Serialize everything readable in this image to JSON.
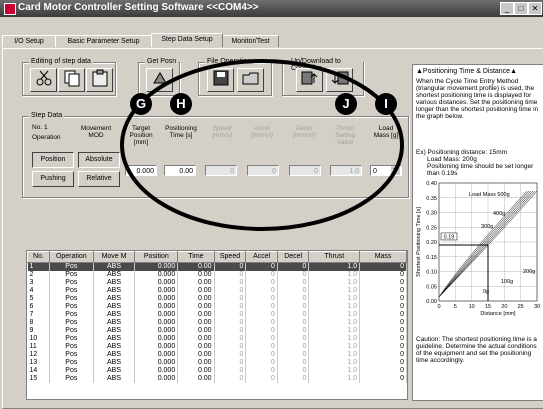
{
  "window": {
    "title": "Card Motor Controller Setting Software <<COM4>>"
  },
  "tabs": [
    "I/O Setup",
    "Basic Parameter Setup",
    "Step Data Setup",
    "Monitor/Test"
  ],
  "toolbar": {
    "editing_label": "Editing of step data",
    "getposn_label": "Get Posn",
    "fileop_label": "File Operation",
    "updown_label": "Up/Download to Controller"
  },
  "markers": [
    "G",
    "H",
    "J",
    "I"
  ],
  "stepdata": {
    "group_label": "Step Data",
    "no_label": "No.",
    "no_value": "1",
    "operation_label": "Operation",
    "movement_label": "Movement MOD",
    "target_label": "Target Position [mm]",
    "postime_label": "Positioning Time [s]",
    "speed_label": "Speed [mm/s]",
    "accel_label": "Accel [mm/s²]",
    "decel_label": "Decel [mm/s²]",
    "thrust_label": "Thrust Setting Value",
    "load_label": "Load Mass [g]",
    "btn_position": "Position",
    "btn_absolute": "Absolute",
    "btn_pushing": "Pushing",
    "btn_relative": "Relative",
    "target_value": "0.000",
    "postime_value": "0.00",
    "speed_value": "0",
    "accel_value": "0",
    "decel_value": "0",
    "thrust_value": "1.0",
    "load_value": "0"
  },
  "table": {
    "headers": [
      "No.",
      "Operation",
      "Move M",
      "Position",
      "Time",
      "Speed",
      "Accel",
      "Decel",
      "Thrust",
      "Mass"
    ],
    "rows": [
      [
        "1",
        "Pos",
        "ABS",
        "0.000",
        "0.00",
        "0",
        "0",
        "0",
        "1.0",
        "0"
      ],
      [
        "2",
        "Pos",
        "ABS",
        "0.000",
        "0.00",
        "0",
        "0",
        "0",
        "1.0",
        "0"
      ],
      [
        "3",
        "Pos",
        "ABS",
        "0.000",
        "0.00",
        "0",
        "0",
        "0",
        "1.0",
        "0"
      ],
      [
        "4",
        "Pos",
        "ABS",
        "0.000",
        "0.00",
        "0",
        "0",
        "0",
        "1.0",
        "0"
      ],
      [
        "5",
        "Pos",
        "ABS",
        "0.000",
        "0.00",
        "0",
        "0",
        "0",
        "1.0",
        "0"
      ],
      [
        "6",
        "Pos",
        "ABS",
        "0.000",
        "0.00",
        "0",
        "0",
        "0",
        "1.0",
        "0"
      ],
      [
        "7",
        "Pos",
        "ABS",
        "0.000",
        "0.00",
        "0",
        "0",
        "0",
        "1.0",
        "0"
      ],
      [
        "8",
        "Pos",
        "ABS",
        "0.000",
        "0.00",
        "0",
        "0",
        "0",
        "1.0",
        "0"
      ],
      [
        "9",
        "Pos",
        "ABS",
        "0.000",
        "0.00",
        "0",
        "0",
        "0",
        "1.0",
        "0"
      ],
      [
        "10",
        "Pos",
        "ABS",
        "0.000",
        "0.00",
        "0",
        "0",
        "0",
        "1.0",
        "0"
      ],
      [
        "11",
        "Pos",
        "ABS",
        "0.000",
        "0.00",
        "0",
        "0",
        "0",
        "1.0",
        "0"
      ],
      [
        "12",
        "Pos",
        "ABS",
        "0.000",
        "0.00",
        "0",
        "0",
        "0",
        "1.0",
        "0"
      ],
      [
        "13",
        "Pos",
        "ABS",
        "0.000",
        "0.00",
        "0",
        "0",
        "0",
        "1.0",
        "0"
      ],
      [
        "14",
        "Pos",
        "ABS",
        "0.000",
        "0.00",
        "0",
        "0",
        "0",
        "1.0",
        "0"
      ],
      [
        "15",
        "Pos",
        "ABS",
        "0.000",
        "0.00",
        "0",
        "0",
        "0",
        "1.0",
        "0"
      ]
    ]
  },
  "help": {
    "title": "▲Positioning Time & Distance▲",
    "para1": "When the Cycle Time Entry Method (triangular movement profile) is used, the shortest positioning time is displayed for various distances. Set the positioning time longer than the shortest positioning time in the graph below.",
    "ex1": "Ex) Positioning distance: 15mm",
    "ex2": "Load Mass: 200g",
    "ex3": "Positioning time should be set longer than 0.19s",
    "chart_ylabel": "Shortest Positioning Time [s]",
    "chart_xlabel": "Distance [mm]",
    "chart_legend": "Load Mass 500g",
    "chart_labels": [
      "400g",
      "300g",
      "200g",
      "100g",
      "0g"
    ],
    "chart_marker_value": "0.19",
    "y_ticks": [
      "0.40",
      "0.35",
      "0.30",
      "0.25",
      "0.20",
      "0.15",
      "0.10",
      "0.05",
      "0.00"
    ],
    "x_ticks": [
      "0",
      "5",
      "10",
      "15",
      "20",
      "25",
      "30"
    ],
    "caution": "Caution: The shortest positioning time is a guideline. Determine the actual conditions of the equipment and set the positioning time accordingly."
  }
}
